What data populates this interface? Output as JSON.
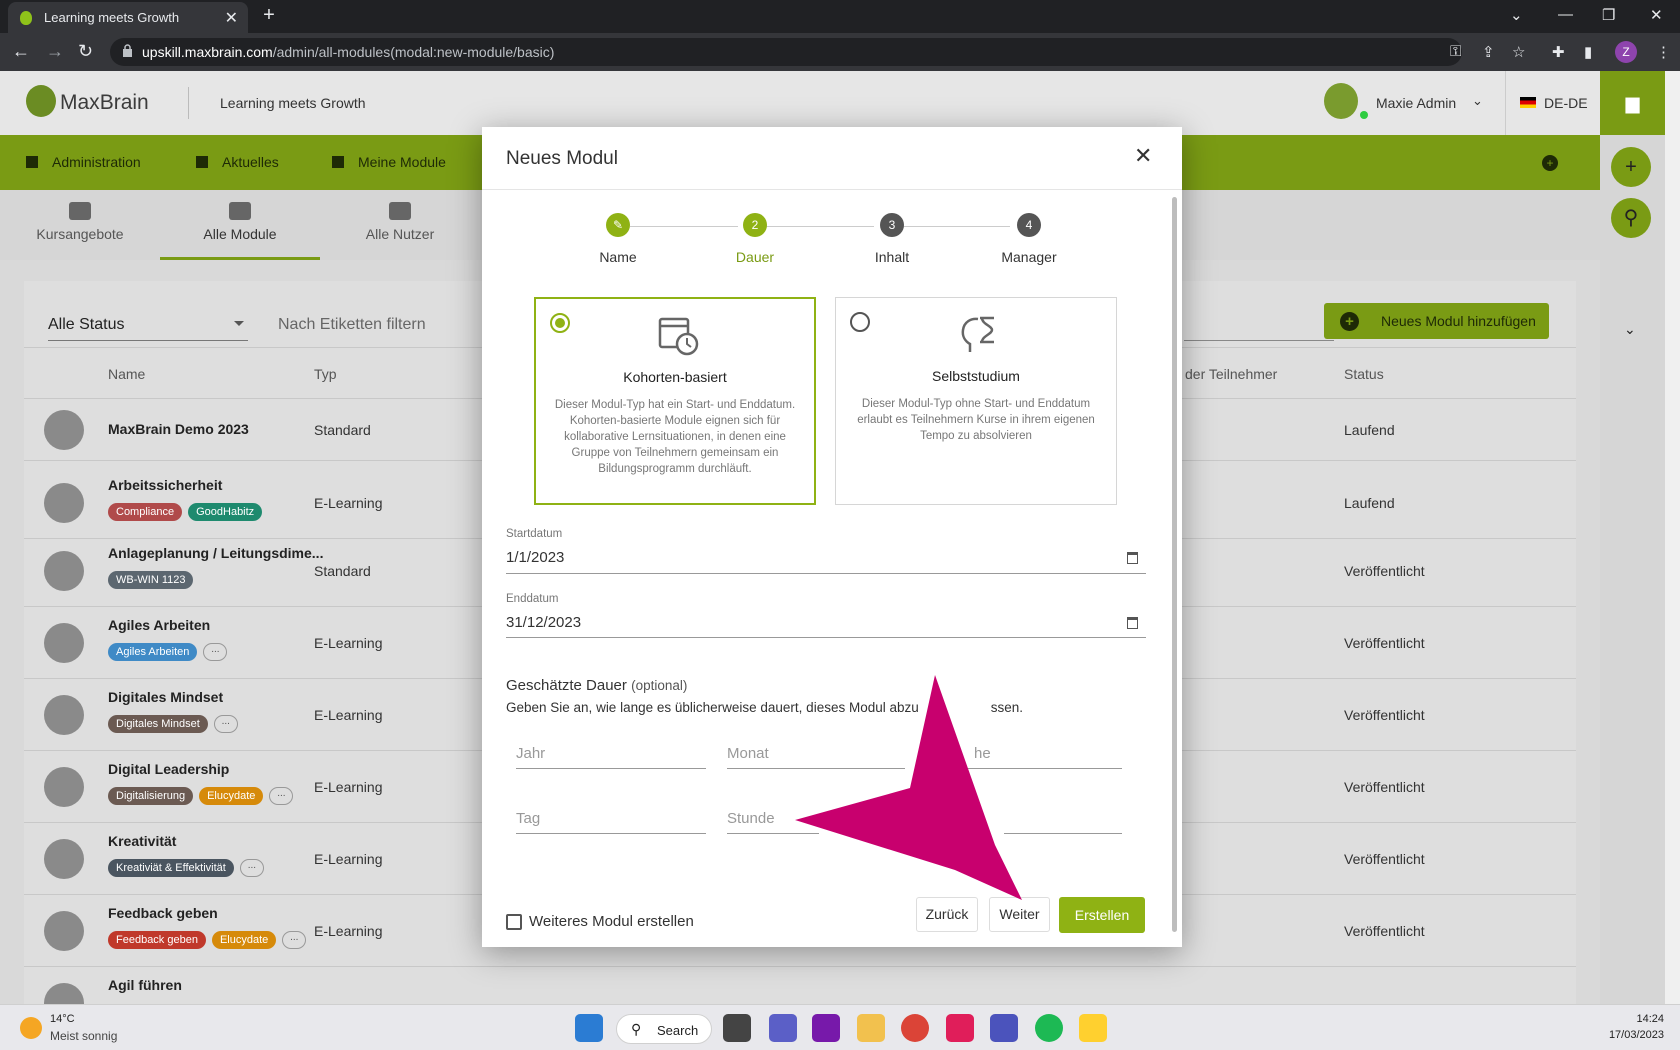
{
  "browser": {
    "tab_title": "Learning meets Growth",
    "url_domain": "upskill.maxbrain.com",
    "url_path": "/admin/all-modules(modal:new-module/basic)",
    "profile_initial": "Z"
  },
  "header": {
    "logo_max": "Max",
    "logo_brain": "Brain",
    "tagline": "Learning meets Growth",
    "user_name": "Maxie Admin",
    "language": "DE-DE"
  },
  "main_nav": [
    {
      "label": "Administration",
      "icon": "admin-icon"
    },
    {
      "label": "Aktuelles",
      "icon": "news-icon"
    },
    {
      "label": "Meine Module",
      "icon": "graduation-cap-icon"
    }
  ],
  "sub_nav": [
    {
      "label": "Kursangebote",
      "icon": "book-icon"
    },
    {
      "label": "Alle Module",
      "icon": "institution-icon",
      "active": true
    },
    {
      "label": "Alle Nutzer",
      "icon": "users-icon"
    }
  ],
  "filters": {
    "status": "Alle Status",
    "tags_placeholder": "Nach Etiketten filtern",
    "add_button": "Neues Modul hinzufügen"
  },
  "table": {
    "headers": {
      "name": "Name",
      "type": "Typ",
      "participants": "der Teilnehmer",
      "status": "Status"
    },
    "rows": [
      {
        "name": "MaxBrain Demo 2023",
        "type": "Standard",
        "status": "Laufend",
        "tags": []
      },
      {
        "name": "Arbeitssicherheit",
        "type": "E-Learning",
        "status": "Laufend",
        "tags": [
          "Compliance",
          "GoodHabitz"
        ],
        "more": false
      },
      {
        "name": "Anlageplanung / Leitungsdime...",
        "type": "Standard",
        "status": "Veröffentlicht",
        "tags": [
          "WB-WIN 1123"
        ],
        "more": false
      },
      {
        "name": "Agiles Arbeiten",
        "type": "E-Learning",
        "status": "Veröffentlicht",
        "tags": [
          "Agiles Arbeiten"
        ],
        "more": true
      },
      {
        "name": "Digitales Mindset",
        "type": "E-Learning",
        "status": "Veröffentlicht",
        "tags": [
          "Digitales Mindset"
        ],
        "more": true
      },
      {
        "name": "Digital Leadership",
        "type": "E-Learning",
        "status": "Veröffentlicht",
        "tags": [
          "Digitalisierung",
          "Elucydate"
        ],
        "more": true
      },
      {
        "name": "Kreativität",
        "type": "E-Learning",
        "status": "Veröffentlicht",
        "tags": [
          "Kreativiät & Effektivität"
        ],
        "more": true
      },
      {
        "name": "Feedback geben",
        "type": "E-Learning",
        "status": "Veröffentlicht",
        "tags": [
          "Feedback geben",
          "Elucydate"
        ],
        "more": true
      },
      {
        "name": "Agil führen",
        "type": "",
        "status": "",
        "tags": []
      }
    ],
    "more_label": "..."
  },
  "tag_colors": {
    "Compliance": "#b04a4a",
    "GoodHabitz": "#1e8a6e",
    "WB-WIN 1123": "#5c6770",
    "Agiles Arbeiten": "#3f8ac6",
    "Digitales Mindset": "#6b5a52",
    "Digitalisierung": "#6b5a52",
    "Elucydate": "#d68a0a",
    "Kreativiät & Effektivität": "#4a5560",
    "Feedback geben": "#c0392b"
  },
  "modal": {
    "title": "Neues Modul",
    "steps": [
      {
        "num": "",
        "label": "Name",
        "state": "done"
      },
      {
        "num": "2",
        "label": "Dauer",
        "state": "current"
      },
      {
        "num": "3",
        "label": "Inhalt",
        "state": "todo"
      },
      {
        "num": "4",
        "label": "Manager",
        "state": "todo"
      }
    ],
    "options": [
      {
        "title": "Kohorten-basiert",
        "desc": "Dieser Modul-Typ hat ein Start- und Enddatum. Kohorten-basierte Module eignen sich für kollaborative Lernsituationen, in denen eine Gruppe von Teilnehmern gemeinsam ein Bildungsprogramm durchläuft.",
        "selected": true
      },
      {
        "title": "Selbststudium",
        "desc": "Dieser Modul-Typ ohne Start- und Enddatum erlaubt es Teilnehmern Kurse in ihrem eigenen Tempo zu absolvieren",
        "selected": false
      }
    ],
    "start_label": "Startdatum",
    "start_value": "1/1/2023",
    "end_label": "Enddatum",
    "end_value": "31/12/2023",
    "duration_title": "Geschätzte Dauer",
    "duration_optional": "(optional)",
    "duration_desc": "Geben Sie an, wie lange es üblicherweise dauert, dieses Modul abzu",
    "duration_desc_end": "ssen.",
    "fields": {
      "year": "Jahr",
      "month": "Monat",
      "week_partial": "he",
      "day": "Tag",
      "hour": "Stunde"
    },
    "checkbox_label": "Weiteres Modul erstellen",
    "back": "Zurück",
    "next": "Weiter",
    "create": "Erstellen"
  },
  "taskbar": {
    "temperature": "14°C",
    "weather": "Meist sonnig",
    "search": "Search",
    "time": "14:24",
    "date": "17/03/2023"
  },
  "colors": {
    "accent": "#8fb214",
    "nav_green": "#7a9b14",
    "annotation": "#c8006e"
  }
}
